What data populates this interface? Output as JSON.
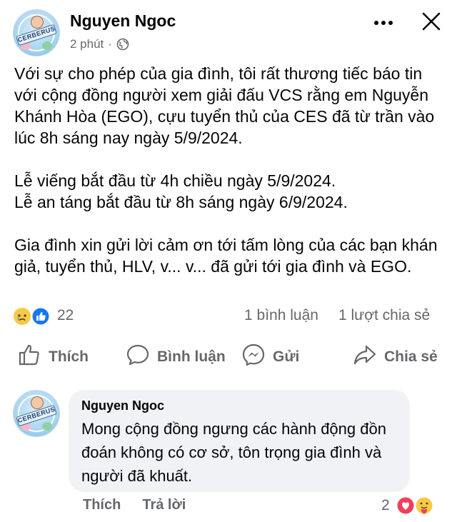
{
  "post": {
    "author": "Nguyen Ngoc",
    "time": "2 phút",
    "separator": "·",
    "paragraphs": [
      "Với sự cho phép của gia đình, tôi rất thương tiếc báo tin với cộng đồng người xem giải đấu VCS rằng em Nguyễn Khánh Hòa (EGO), cựu tuyển thủ của CES đã từ trần vào lúc 8h sáng nay ngày 5/9/2024.",
      "Lễ viếng bắt đầu từ 4h chiều ngày 5/9/2024.\nLễ an táng bắt đầu từ 8h sáng ngày 6/9/2024.",
      "Gia đình xin gửi lời cảm ơn tới tấm lòng của các bạn khán giả, tuyển thủ, HLV, v... v... đã gửi tới gia đình và EGO."
    ],
    "avatar_text": "CERBERUS"
  },
  "stats": {
    "reactions": "22",
    "comments": "1 bình luận",
    "shares": "1 lượt chia sẻ"
  },
  "actions": {
    "like": "Thích",
    "comment": "Bình luận",
    "send": "Gửi",
    "share": "Chia sẻ"
  },
  "comment": {
    "author": "Nguyen Ngoc",
    "text": "Mong cộng đồng ngưng các hành động đồn đoán không có cơ sở, tôn trọng gia đình và người đã khuất.",
    "like": "Thích",
    "reply": "Trả lời",
    "reactions": "2"
  },
  "icons": {
    "close": "close-icon",
    "more": "more-options-icon",
    "audience": "globe-icon",
    "like": "thumbs-up-icon",
    "comment": "speech-bubble-icon",
    "send": "messenger-icon",
    "share": "share-arrow-icon",
    "reaction_sad": "sad-reaction-icon",
    "reaction_like": "like-reaction-icon",
    "reaction_love": "love-reaction-icon",
    "reaction_care": "care-reaction-icon"
  },
  "colors": {
    "text_primary": "#050505",
    "text_secondary": "#65676b",
    "like_blue": "#1877f2",
    "sad_yellow": "#f7c948",
    "love_red": "#f33e58",
    "bubble_bg": "#f0f2f5"
  }
}
